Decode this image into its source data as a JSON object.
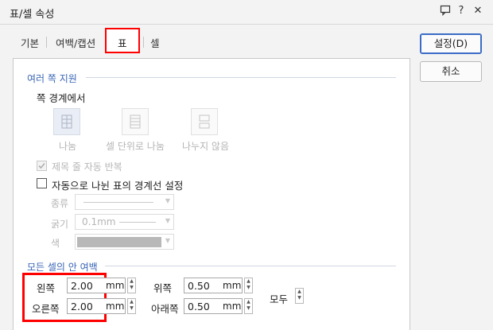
{
  "window": {
    "title": "표/셀 속성",
    "icons": [
      "chat-icon",
      "help-icon",
      "close-icon"
    ],
    "help_glyph": "?",
    "close_glyph": "✕"
  },
  "tabs": [
    {
      "label": "기본"
    },
    {
      "label": "여백/캡션"
    },
    {
      "label": "표",
      "active": true
    },
    {
      "label": "셀"
    }
  ],
  "buttons": {
    "ok": "설정(D)",
    "cancel": "취소"
  },
  "split": {
    "section_title": "여러 쪽 지원",
    "subtitle": "쪽 경계에서",
    "options": [
      {
        "label": "나눔",
        "selected": true
      },
      {
        "label": "셀 단위로 나눔"
      },
      {
        "label": "나누지 않음"
      }
    ],
    "repeat_title_label": "제목 줄 자동 반복",
    "repeat_title_checked": true,
    "auto_border_label": "자동으로 나뉜 표의 경계선 설정",
    "auto_border_checked": false,
    "type_label": "종류",
    "thickness_label": "굵기",
    "thickness_value": "0.1mm",
    "color_label": "색"
  },
  "margins": {
    "section_title": "모든 셀의 안 여백",
    "left_label": "왼쪽",
    "left_value": "2.00",
    "right_label": "오른쪽",
    "right_value": "2.00",
    "top_label": "위쪽",
    "top_value": "0.50",
    "bottom_label": "아래쪽",
    "bottom_value": "0.50",
    "all_label": "모두",
    "unit": "mm"
  },
  "colors": {
    "accent": "#3a66b5",
    "highlight": "#ff0000"
  }
}
